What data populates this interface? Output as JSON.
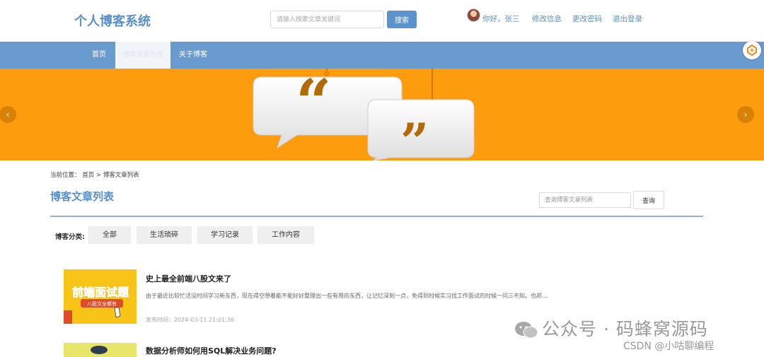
{
  "header": {
    "site_title": "个人博客系统",
    "search_placeholder": "请输入搜索文章关键词",
    "search_button": "搜索",
    "greeting": "你好，张三",
    "edit_profile": "修改信息",
    "change_password": "更改密码",
    "logout": "退出登录"
  },
  "nav": {
    "items": [
      {
        "label": "首页"
      },
      {
        "label": "博客文章列表"
      },
      {
        "label": "关于博客"
      }
    ]
  },
  "banner": {
    "prev_icon": "chevron-left-icon",
    "next_icon": "chevron-right-icon"
  },
  "breadcrumb": "当前位置： 首页 > 博客文章列表",
  "list": {
    "title": "博客文章列表",
    "search_placeholder": "查询博客文章列表",
    "query_button": "查询"
  },
  "categories": {
    "label": "博客分类:",
    "items": [
      "全部",
      "生活琐碎",
      "学习记录",
      "工作内容"
    ]
  },
  "posts": [
    {
      "thumb_text": "前端面试题",
      "thumb_badge": "八股文全都有",
      "title": "史上最全前端八股文来了",
      "summary": "由于最近比较忙活没时间学习新东西，现在得空想着能不能好好整理出一些有用的东西，让记忆深刻一点，免得到时候实习找工作面试的时候一问三不知。也邦...",
      "time": "发布时间：2024-03-11 21:01:36"
    },
    {
      "title": "数据分析师如何用SQL解决业务问题?"
    }
  ],
  "watermark": {
    "line1": "公众号 · 码蜂窝源码",
    "line2": "CSDN @小咕聊编程"
  },
  "colors": {
    "brand": "#5b8fc7",
    "nav": "#6a9bcf",
    "banner": "#fd9c0c"
  }
}
